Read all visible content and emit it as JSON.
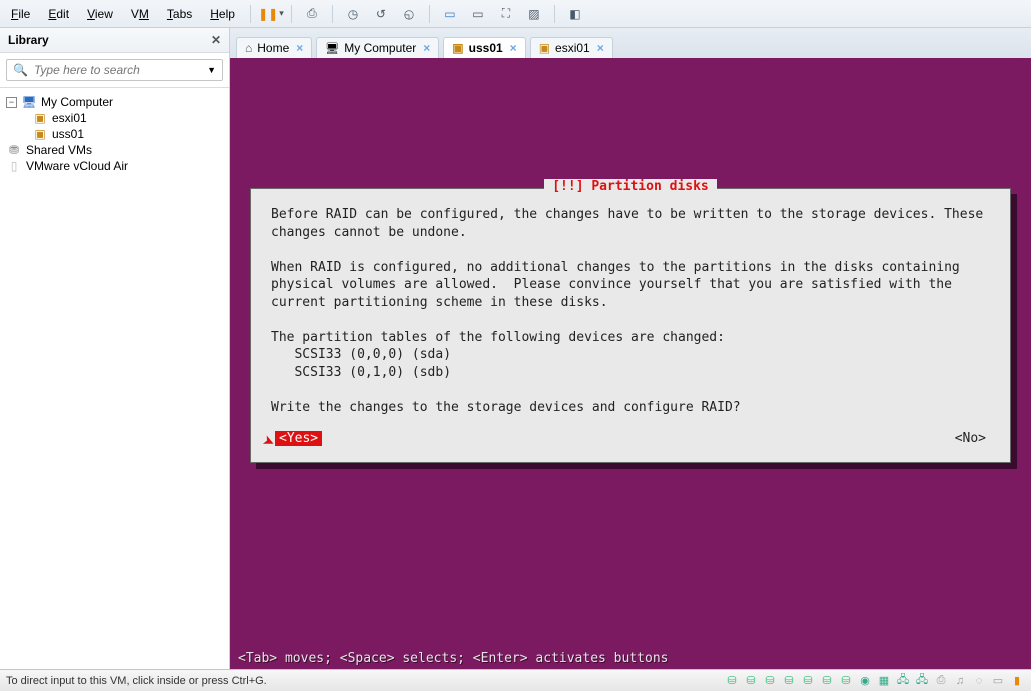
{
  "menubar": {
    "items": [
      "File",
      "Edit",
      "View",
      "VM",
      "Tabs",
      "Help"
    ]
  },
  "sidebar": {
    "title": "Library",
    "search_placeholder": "Type here to search",
    "tree": {
      "root": "My Computer",
      "vms": [
        "esxi01",
        "uss01"
      ],
      "shared": "Shared VMs",
      "cloud": "VMware vCloud Air"
    }
  },
  "tabs": [
    {
      "label": "Home",
      "icon": "home",
      "active": false,
      "closeable": true
    },
    {
      "label": "My Computer",
      "icon": "comp",
      "active": false,
      "closeable": true
    },
    {
      "label": "uss01",
      "icon": "vm",
      "active": true,
      "closeable": true
    },
    {
      "label": "esxi01",
      "icon": "vm",
      "active": false,
      "closeable": true
    }
  ],
  "installer": {
    "title": "[!!] Partition disks",
    "body": "Before RAID can be configured, the changes have to be written to the storage devices. These changes cannot be undone.\n\nWhen RAID is configured, no additional changes to the partitions in the disks containing physical volumes are allowed.  Please convince yourself that you are satisfied with the current partitioning scheme in these disks.\n\nThe partition tables of the following devices are changed:\n   SCSI33 (0,0,0) (sda)\n   SCSI33 (0,1,0) (sdb)\n\nWrite the changes to the storage devices and configure RAID?",
    "yes": "<Yes>",
    "no": "<No>",
    "hint": "<Tab> moves; <Space> selects; <Enter> activates buttons"
  },
  "statusbar": {
    "message": "To direct input to this VM, click inside or press Ctrl+G."
  }
}
